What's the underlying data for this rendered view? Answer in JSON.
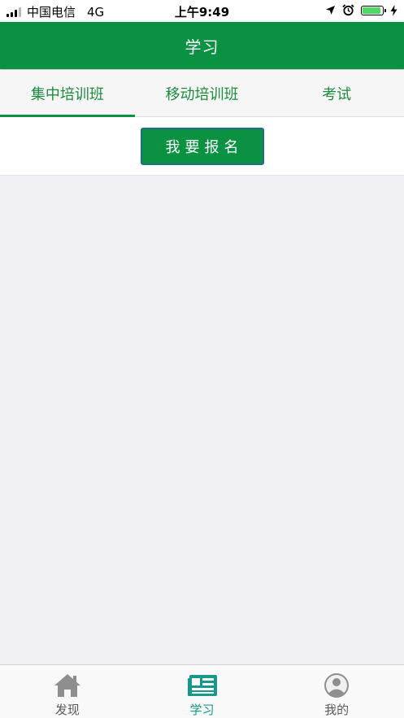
{
  "status_bar": {
    "carrier": "中国电信",
    "network": "4G",
    "time": "上午9:49"
  },
  "header": {
    "title": "学习"
  },
  "tabs": [
    {
      "label": "集中培训班",
      "active": true
    },
    {
      "label": "移动培训班",
      "active": false
    },
    {
      "label": "考试",
      "active": false
    }
  ],
  "action": {
    "signup_label": "我要报名"
  },
  "tabbar": {
    "items": [
      {
        "label": "发现",
        "icon": "home-icon",
        "active": false
      },
      {
        "label": "学习",
        "icon": "study-icon",
        "active": true
      },
      {
        "label": "我的",
        "icon": "profile-icon",
        "active": false
      }
    ]
  },
  "colors": {
    "brand_green": "#0a9142",
    "tab_text": "#1a8c3c",
    "tabbar_active": "#16998a",
    "tabbar_inactive": "#8e8e8e"
  }
}
